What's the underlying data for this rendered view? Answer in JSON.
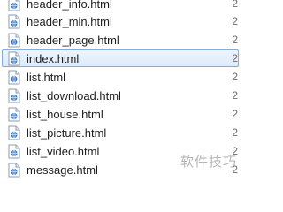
{
  "files": [
    {
      "name": "header_info.html",
      "date": "2",
      "selected": false
    },
    {
      "name": "header_min.html",
      "date": "2",
      "selected": false
    },
    {
      "name": "header_page.html",
      "date": "2",
      "selected": false
    },
    {
      "name": "index.html",
      "date": "2",
      "selected": true
    },
    {
      "name": "list.html",
      "date": "2",
      "selected": false
    },
    {
      "name": "list_download.html",
      "date": "2",
      "selected": false
    },
    {
      "name": "list_house.html",
      "date": "2",
      "selected": false
    },
    {
      "name": "list_picture.html",
      "date": "2",
      "selected": false
    },
    {
      "name": "list_video.html",
      "date": "2",
      "selected": false
    },
    {
      "name": "message.html",
      "date": "2",
      "selected": false
    }
  ],
  "icon": "html-file-icon",
  "colors": {
    "selection_border": "#84acdd",
    "selection_fill": "#dcebfc",
    "icon_blue": "#3d7fd1"
  },
  "watermark": "软件技巧"
}
